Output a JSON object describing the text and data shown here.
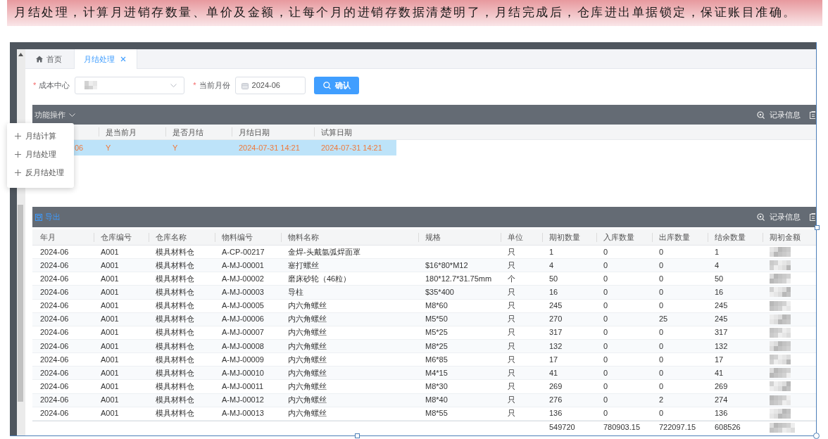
{
  "banner": {
    "text": "月结处理，计算月进销存数量、单价及金额，让每个月的进销存数据清楚明了，月结完成后，仓库进出单据锁定，保证账目准确。"
  },
  "tabs": [
    {
      "label": "首页",
      "kind": "home",
      "selected": false,
      "closable": false
    },
    {
      "label": "月结处理",
      "kind": "page",
      "selected": true,
      "closable": true
    }
  ],
  "filters": [
    {
      "kind": "select",
      "required_mark": "*",
      "label": "成本中心",
      "blurred": true
    },
    {
      "kind": "date",
      "required_mark": "*",
      "label": "当前月份",
      "value": "2024-06"
    }
  ],
  "confirm_button": {
    "label": "确认"
  },
  "period_panel": {
    "actions_menu": {
      "label": "功能操作",
      "expanded": true,
      "items": [
        "月结计算",
        "月结处理",
        "反月结处理"
      ]
    },
    "record_info": "记录信息",
    "columns": [
      null,
      "是当前月",
      "是否月结",
      "月结日期",
      "试算日期"
    ],
    "rows": [
      {
        "selected": true,
        "cells": [
          "06",
          "Y",
          "Y",
          "2024-07-31 14:21",
          "2024-07-31 14:21"
        ]
      }
    ]
  },
  "detail_panel": {
    "export": "导出",
    "record_info": "记录信息",
    "columns": [
      {
        "title": "年月",
        "kind": "text"
      },
      {
        "title": "仓库编号",
        "kind": "text"
      },
      {
        "title": "仓库名称",
        "kind": "text"
      },
      {
        "title": "物料编号",
        "kind": "text"
      },
      {
        "title": "物料名称",
        "kind": "text"
      },
      {
        "title": "规格",
        "kind": "text"
      },
      {
        "title": "单位",
        "kind": "text"
      },
      {
        "title": "期初数量",
        "kind": "text",
        "total": "549720"
      },
      {
        "title": "入库数量",
        "kind": "text",
        "total": "780903.15"
      },
      {
        "title": "出库数量",
        "kind": "text",
        "total": "722097.15"
      },
      {
        "title": "结余数量",
        "kind": "text",
        "total": "608526"
      },
      {
        "title": "期初金额",
        "kind": "blurred"
      }
    ],
    "rows": [
      [
        "2024-06",
        "A001",
        "模具材料仓",
        "A-CP-00217",
        "金焊-头戴氩弧焊面罩",
        null,
        "只",
        "1",
        "0",
        "0",
        "1"
      ],
      [
        "2024-06",
        "A001",
        "模具材料仓",
        "A-MJ-00001",
        "塞打螺丝",
        "$16*80*M12",
        "只",
        "4",
        "0",
        "0",
        "4"
      ],
      [
        "2024-06",
        "A001",
        "模具材料仓",
        "A-MJ-00002",
        "磨床砂轮（46粒）",
        "180*12.7*31.75mm",
        "个",
        "50",
        "0",
        "0",
        "50"
      ],
      [
        "2024-06",
        "A001",
        "模具材料仓",
        "A-MJ-00003",
        "导柱",
        "$35*400",
        "只",
        "16",
        "0",
        "0",
        "16"
      ],
      [
        "2024-06",
        "A001",
        "模具材料仓",
        "A-MJ-00005",
        "内六角螺丝",
        "M8*60",
        "只",
        "245",
        "0",
        "0",
        "245"
      ],
      [
        "2024-06",
        "A001",
        "模具材料仓",
        "A-MJ-00006",
        "内六角螺丝",
        "M5*50",
        "只",
        "270",
        "0",
        "25",
        "245"
      ],
      [
        "2024-06",
        "A001",
        "模具材料仓",
        "A-MJ-00007",
        "内六角螺丝",
        "M5*25",
        "只",
        "317",
        "0",
        "0",
        "317"
      ],
      [
        "2024-06",
        "A001",
        "模具材料仓",
        "A-MJ-00008",
        "内六角螺丝",
        "M8*25",
        "只",
        "132",
        "0",
        "0",
        "132"
      ],
      [
        "2024-06",
        "A001",
        "模具材料仓",
        "A-MJ-00009",
        "内六角螺丝",
        "M6*85",
        "只",
        "17",
        "0",
        "0",
        "17"
      ],
      [
        "2024-06",
        "A001",
        "模具材料仓",
        "A-MJ-00010",
        "内六角螺丝",
        "M4*15",
        "只",
        "41",
        "0",
        "0",
        "41"
      ],
      [
        "2024-06",
        "A001",
        "模具材料仓",
        "A-MJ-00011",
        "内六角螺丝",
        "M8*30",
        "只",
        "269",
        "0",
        "0",
        "269"
      ],
      [
        "2024-06",
        "A001",
        "模具材料仓",
        "A-MJ-00012",
        "内六角螺丝",
        "M8*40",
        "只",
        "276",
        "0",
        "2",
        "274"
      ],
      [
        "2024-06",
        "A001",
        "模具材料仓",
        "A-MJ-00013",
        "内六角螺丝",
        "M8*55",
        "只",
        "136",
        "0",
        "0",
        "136"
      ]
    ]
  }
}
